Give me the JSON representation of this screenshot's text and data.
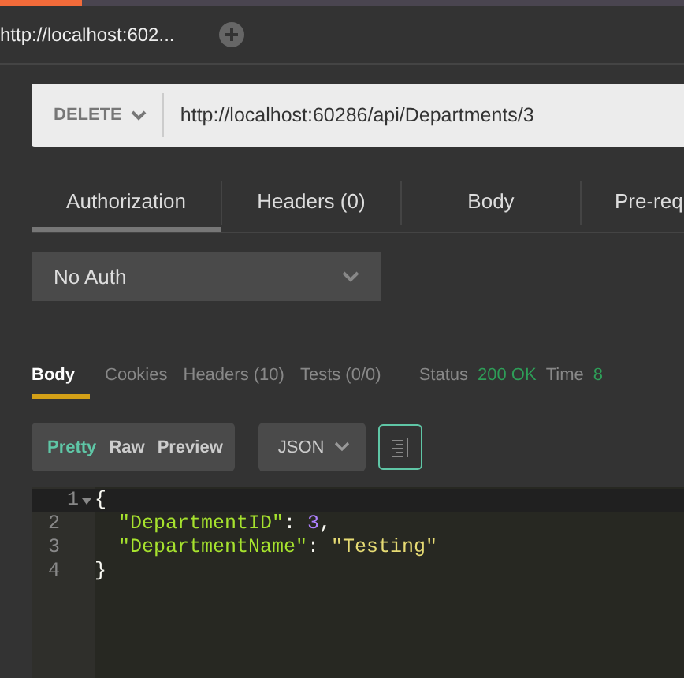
{
  "open_tabs": [
    {
      "label": "http://localhost:602...",
      "selected": true
    }
  ],
  "request": {
    "method": "DELETE",
    "url": "http://localhost:60286/api/Departments/3"
  },
  "request_tabs": [
    {
      "label": "Authorization",
      "selected": true
    },
    {
      "label": "Headers (0)",
      "selected": false
    },
    {
      "label": "Body",
      "selected": false
    },
    {
      "label": "Pre-req",
      "selected": false
    }
  ],
  "auth_type": "No Auth",
  "response_tabs": [
    {
      "label": "Body",
      "selected": true
    },
    {
      "label": "Cookies",
      "selected": false
    },
    {
      "label": "Headers (10)",
      "selected": false
    },
    {
      "label": "Tests (0/0)",
      "selected": false
    }
  ],
  "status": {
    "status_label": "Status",
    "status_value": "200 OK",
    "time_label": "Time",
    "time_value": "8"
  },
  "view_modes": [
    {
      "label": "Pretty",
      "selected": true
    },
    {
      "label": "Raw",
      "selected": false
    },
    {
      "label": "Preview",
      "selected": false
    }
  ],
  "format": "JSON",
  "wrap_lines": true,
  "code_lines": [
    {
      "number": "1",
      "foldable": true,
      "current": true,
      "tokens": [
        {
          "kind": "punct",
          "text": "{"
        }
      ]
    },
    {
      "number": "2",
      "foldable": false,
      "current": false,
      "indented": true,
      "tokens": [
        {
          "kind": "key",
          "text": "\"DepartmentID\""
        },
        {
          "kind": "punct",
          "text": ": "
        },
        {
          "kind": "number",
          "text": "3"
        },
        {
          "kind": "punct",
          "text": ","
        }
      ]
    },
    {
      "number": "3",
      "foldable": false,
      "current": false,
      "indented": true,
      "tokens": [
        {
          "kind": "key",
          "text": "\"DepartmentName\""
        },
        {
          "kind": "punct",
          "text": ": "
        },
        {
          "kind": "string",
          "text": "\"Testing\""
        }
      ]
    },
    {
      "number": "4",
      "foldable": false,
      "current": false,
      "tokens": [
        {
          "kind": "punct",
          "text": "}"
        }
      ]
    }
  ]
}
